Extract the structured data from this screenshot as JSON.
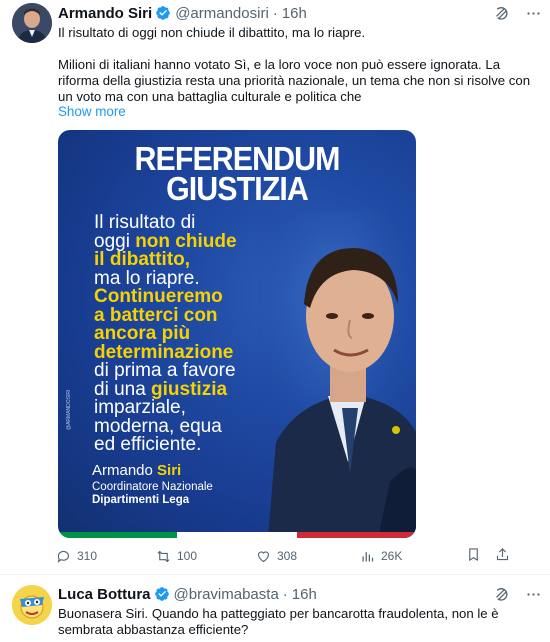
{
  "tweet": {
    "author_name": "Armando Siri",
    "author_handle": "@armandosiri",
    "separator": "·",
    "time": "16h",
    "text_line1": "Il risultato di oggi non chiude il dibattito, ma lo riapre.",
    "text_para2": "Milioni di italiani hanno votato Sì, e la loro voce non può essere ignorata. La riforma della giustizia resta una priorità nazionale, un tema che non si risolve con un voto ma con una battaglia culturale e politica che",
    "show_more": "Show more",
    "media": {
      "title_line1": "REFERENDUM",
      "title_line2": "GIUSTIZIA",
      "body_lines": [
        {
          "w": "Il risultato di",
          "y": ""
        },
        {
          "w": "oggi ",
          "y": "non chiude"
        },
        {
          "w": "",
          "y": "il dibattito,"
        },
        {
          "w": "ma lo riapre.",
          "y": ""
        },
        {
          "w": "",
          "y": "Continueremo"
        },
        {
          "w": "",
          "y": "a batterci con"
        },
        {
          "w": "",
          "y": "ancora più"
        },
        {
          "w": "",
          "y": "determinazione"
        },
        {
          "w": "di prima a favore",
          "y": ""
        },
        {
          "w": "di una ",
          "y": "giustizia"
        },
        {
          "w": "imparziale,",
          "y": ""
        },
        {
          "w": "moderna, equa",
          "y": ""
        },
        {
          "w": "ed efficiente.",
          "y": ""
        }
      ],
      "signature_first": "Armando ",
      "signature_last": "Siri",
      "role_line1": "Coordinatore Nazionale",
      "role_line2": "Dipartimenti Lega",
      "side_credit": "@ARMANDOSIRI"
    },
    "stats": {
      "replies": "310",
      "retweets": "100",
      "likes": "308",
      "views": "26K"
    },
    "colors": {
      "accent": "#1d9bf0",
      "media_blue": "#1f4aa4",
      "highlight_yellow": "#f6d200",
      "flag_green": "#009246",
      "flag_white": "#ffffff",
      "flag_red": "#ce2b37"
    }
  },
  "reply": {
    "author_name": "Luca Bottura",
    "author_handle": "@bravimabasta",
    "separator": "·",
    "time": "16h",
    "text": "Buonasera Siri. Quando ha patteggiato per bancarotta fraudolenta, non le è sembrata abbastanza efficiente?"
  },
  "icons": {
    "verified": "verified-badge-icon",
    "grok": "grok-icon",
    "more": "more-icon",
    "reply": "reply-icon",
    "retweet": "retweet-icon",
    "like": "heart-icon",
    "views": "views-icon",
    "bookmark": "bookmark-icon",
    "share": "share-icon"
  }
}
